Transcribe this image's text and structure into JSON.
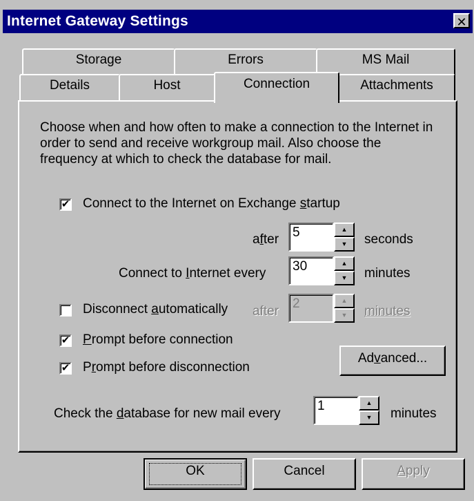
{
  "window": {
    "title": "Internet Gateway Settings",
    "close_glyph": "✕"
  },
  "tabs_row1": [
    "Storage",
    "Errors",
    "MS Mail"
  ],
  "tabs_row2": [
    "Details",
    "Host",
    "Connection",
    "Attachments"
  ],
  "active_tab": "Connection",
  "description": "Choose when and how often to make a connection to the Internet in order to send and receive workgroup mail. Also choose the frequency at which to check the database for mail.",
  "connect_startup": {
    "checked": true,
    "pre": "Connect to the Internet on Exchange ",
    "u": "s",
    "post": "tartup"
  },
  "after": {
    "pre": "a",
    "u": "f",
    "post": "ter",
    "value": "5",
    "unit": "seconds"
  },
  "connect_every": {
    "pre": "Connect to ",
    "u": "I",
    "post": "nternet every",
    "value": "30",
    "unit": "minutes"
  },
  "disconnect": {
    "checked": false,
    "pre": "Disconnect ",
    "u": "a",
    "post": "utomatically",
    "after_label": "after",
    "value": "2",
    "unit": "minutes"
  },
  "prompt_connection": {
    "checked": true,
    "u": "P",
    "post": "rompt before connection"
  },
  "prompt_disconnection": {
    "checked": true,
    "pre": "P",
    "u": "r",
    "post": "ompt before disconnection"
  },
  "advanced_button": {
    "pre": "Ad",
    "u": "v",
    "post": "anced..."
  },
  "check_db": {
    "pre": "Check the ",
    "u": "d",
    "post": "atabase for new mail every",
    "value": "1",
    "unit": "minutes"
  },
  "buttons": {
    "ok": "OK",
    "cancel": "Cancel",
    "apply_u": "A",
    "apply_post": "pply"
  },
  "check_glyph": "✔",
  "spin_up_glyph": "▲",
  "spin_down_glyph": "▼"
}
